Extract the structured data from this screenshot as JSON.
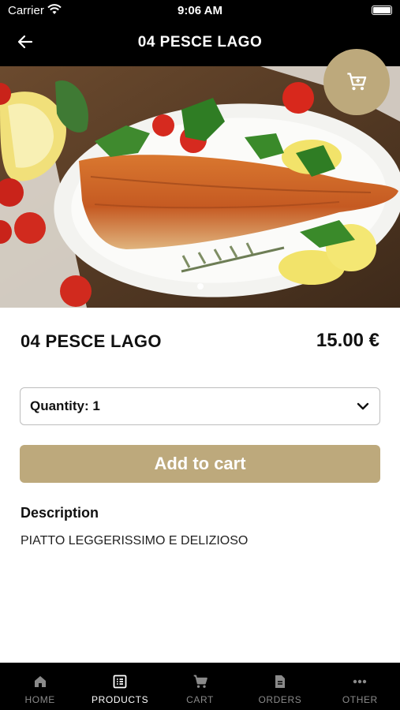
{
  "status": {
    "carrier": "Carrier",
    "time": "9:06 AM"
  },
  "header": {
    "title": "04 PESCE LAGO",
    "back_icon": "arrow-left-icon"
  },
  "product": {
    "name": "04 PESCE LAGO",
    "price": "15.00 €",
    "quantity_label": "Quantity: 1",
    "add_to_cart": "Add to cart",
    "description_heading": "Description",
    "description": "PIATTO LEGGERISSIMO E DELIZIOSO",
    "image_pages": 1,
    "image_current": 1
  },
  "tabs": [
    {
      "label": "HOME",
      "icon": "home-icon",
      "active": false
    },
    {
      "label": "PRODUCTS",
      "icon": "list-icon",
      "active": true
    },
    {
      "label": "CART",
      "icon": "cart-icon",
      "active": false
    },
    {
      "label": "ORDERS",
      "icon": "document-icon",
      "active": false
    },
    {
      "label": "OTHER",
      "icon": "more-icon",
      "active": false
    }
  ],
  "colors": {
    "accent": "#bda97c",
    "bar": "#000000",
    "tab_inactive": "#8a8a8a"
  }
}
